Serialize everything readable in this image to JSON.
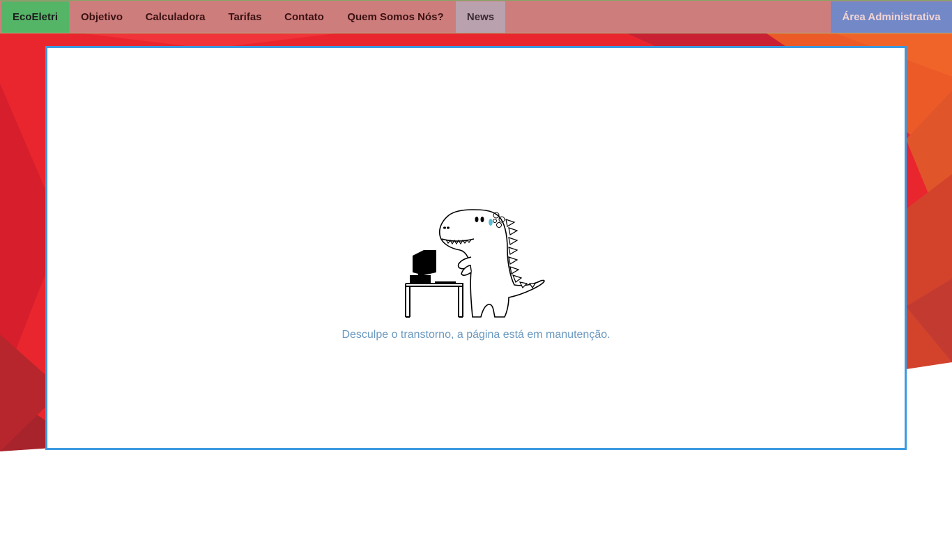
{
  "nav": {
    "brand": "EcoEletri",
    "items": [
      {
        "label": "Objetivo"
      },
      {
        "label": "Calculadora"
      },
      {
        "label": "Tarifas"
      },
      {
        "label": "Contato"
      },
      {
        "label": "Quem Somos Nós?"
      },
      {
        "label": "News",
        "active": true
      }
    ],
    "admin": "Área Administrativa"
  },
  "main": {
    "message": "Desculpe o transtorno, a página está em manutenção."
  },
  "colors": {
    "brand_bg": "#55b567",
    "active_bg": "#b9a1ae",
    "admin_bg": "#7288c7",
    "panel_border": "#3d9ae0",
    "message_text": "#6a98bf"
  }
}
